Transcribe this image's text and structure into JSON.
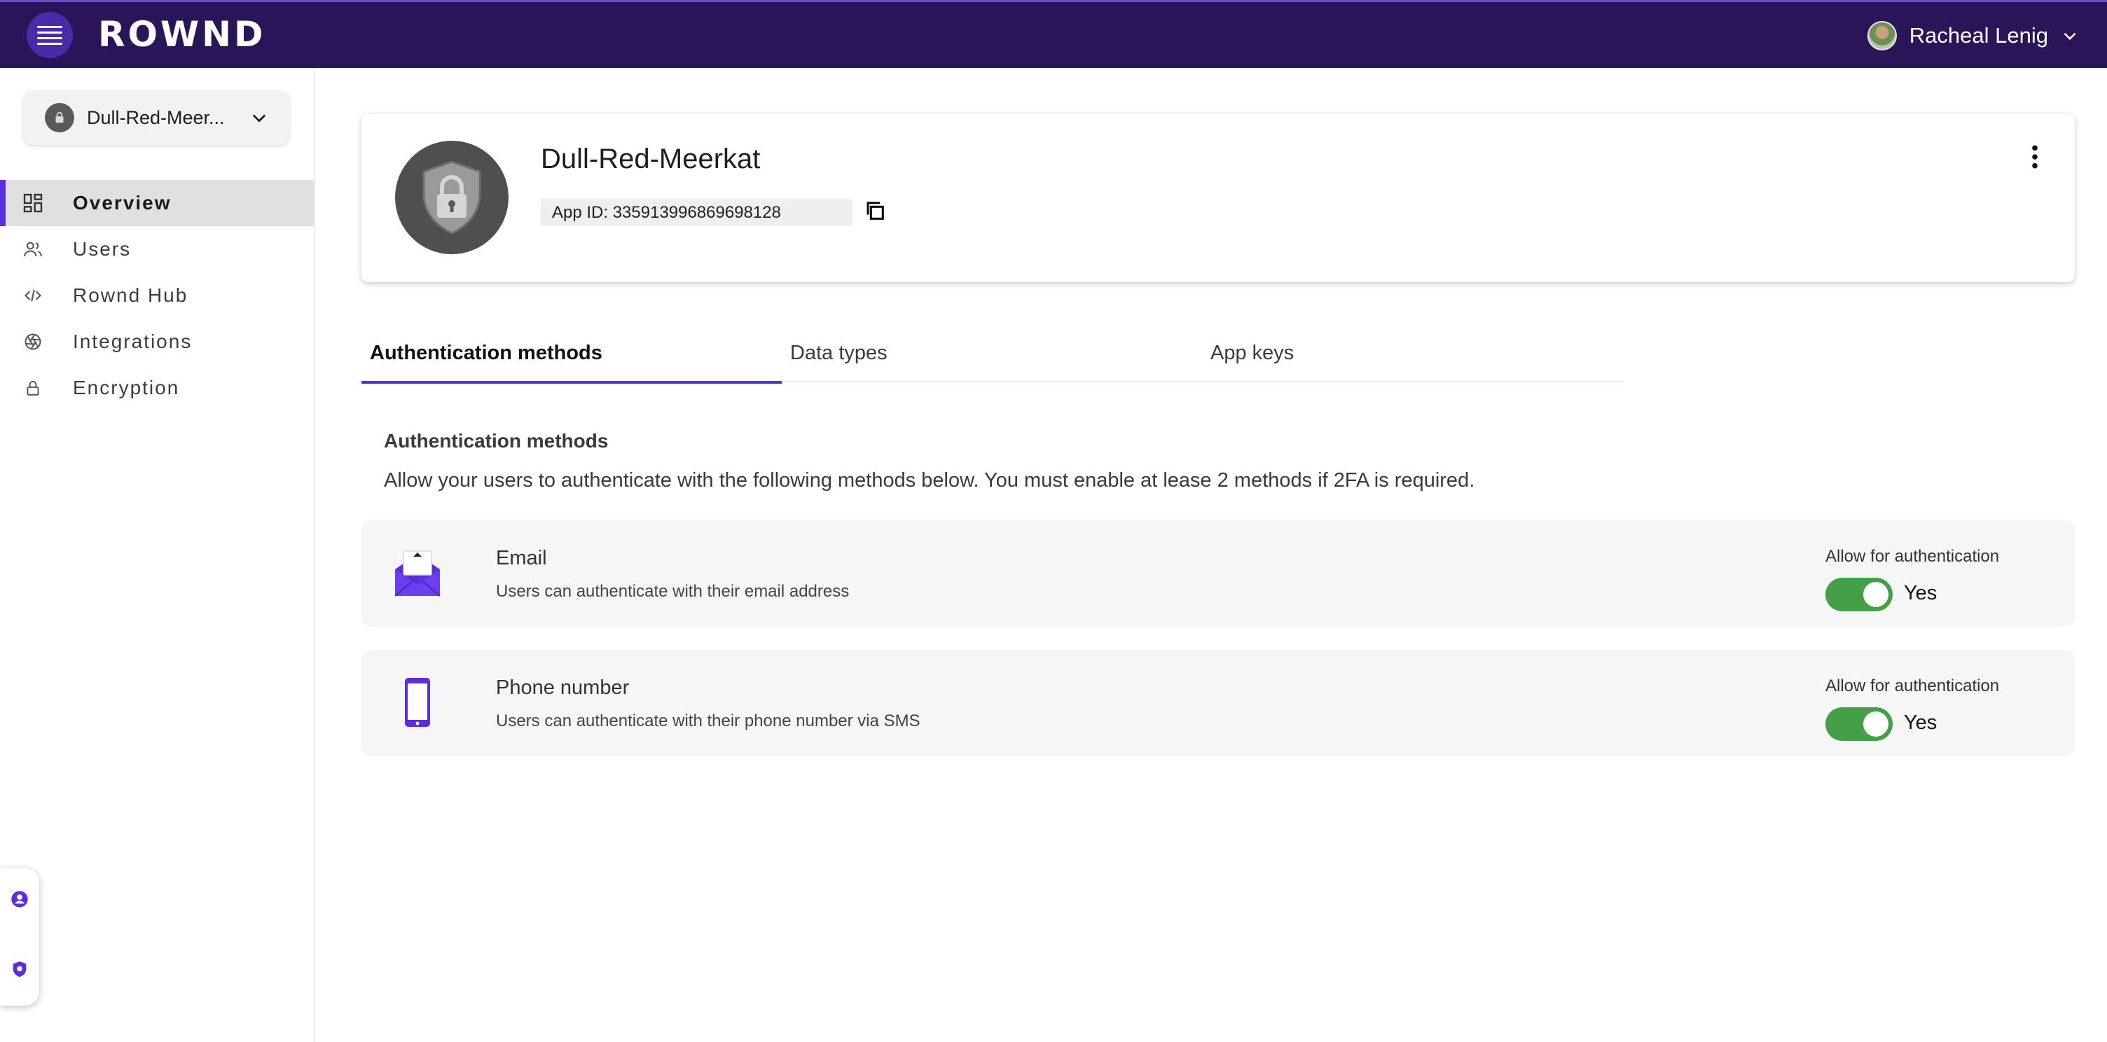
{
  "header": {
    "logo_text": "ROWND",
    "user_name": "Racheal Lenig",
    "brand_color": "#2a1559",
    "accent_color": "#5b2ddb"
  },
  "sidebar": {
    "app_select_label": "Dull-Red-Meer...",
    "items": [
      {
        "label": "Overview",
        "icon": "dashboard-icon"
      },
      {
        "label": "Users",
        "icon": "users-icon"
      },
      {
        "label": "Rownd Hub",
        "icon": "code-icon"
      },
      {
        "label": "Integrations",
        "icon": "aperture-icon"
      },
      {
        "label": "Encryption",
        "icon": "lock-icon"
      }
    ]
  },
  "app_card": {
    "name": "Dull-Red-Meerkat",
    "app_id": "App ID: 335913996869698128"
  },
  "tabs": [
    {
      "label": "Authentication methods",
      "active": true
    },
    {
      "label": "Data types",
      "active": false
    },
    {
      "label": "App keys",
      "active": false
    }
  ],
  "auth_section": {
    "title": "Authentication methods",
    "description": "Allow your users to authenticate with the following methods below. You must enable at lease 2 methods if 2FA is required."
  },
  "methods": [
    {
      "title": "Email",
      "description": "Users can authenticate with their email address",
      "allow_label": "Allow for authentication",
      "toggle_text": "Yes",
      "enabled": true,
      "icon": "envelope-icon"
    },
    {
      "title": "Phone number",
      "description": "Users can authenticate with their phone number via SMS",
      "allow_label": "Allow for authentication",
      "toggle_text": "Yes",
      "enabled": true,
      "icon": "phone-icon"
    }
  ],
  "colors": {
    "toggle_on": "#43a047"
  }
}
